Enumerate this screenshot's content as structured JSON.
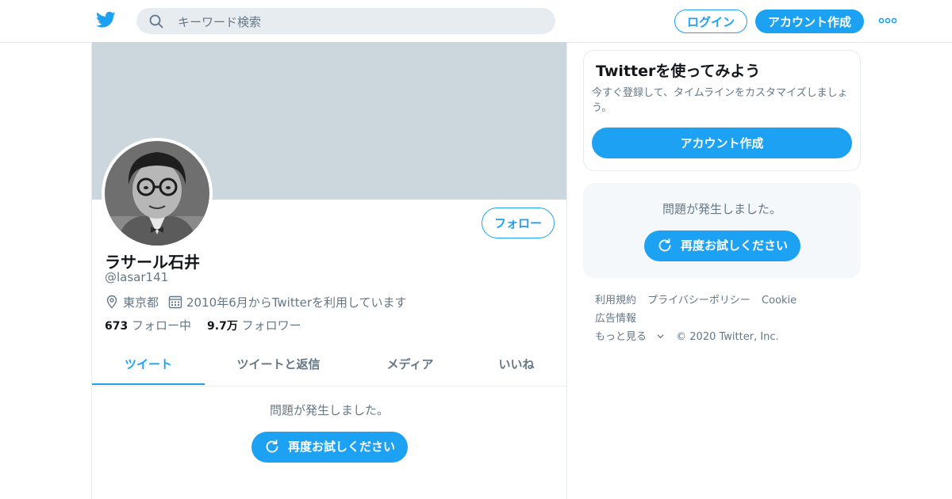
{
  "header": {
    "search_placeholder": "キーワード検索",
    "login_label": "ログイン",
    "signup_label": "アカウント作成"
  },
  "profile": {
    "display_name": "ラサール石井",
    "handle": "@lasar141",
    "follow_label": "フォロー",
    "location": "東京都",
    "joined": "2010年6月からTwitterを利用しています",
    "following_count": "673",
    "following_label": "フォロー中",
    "followers_count": "9.7万",
    "followers_label": "フォロワー"
  },
  "tabs": [
    {
      "label": "ツイート",
      "active": true
    },
    {
      "label": "ツイートと返信",
      "active": false
    },
    {
      "label": "メディア",
      "active": false
    },
    {
      "label": "いいね",
      "active": false
    }
  ],
  "timeline": {
    "error_text": "問題が発生しました。",
    "retry_label": "再度お試しください"
  },
  "sidebar": {
    "card_title": "Twitterを使ってみよう",
    "card_desc": "今すぐ登録して、タイムラインをカスタマイズしましょう。",
    "card_signup": "アカウント作成",
    "error_text": "問題が発生しました。",
    "retry_label": "再度お試しください"
  },
  "footer": {
    "terms": "利用規約",
    "privacy": "プライバシーポリシー",
    "cookie": "Cookie",
    "ads": "広告情報",
    "more": "もっと見る",
    "copyright": "© 2020 Twitter, Inc."
  },
  "colors": {
    "accent": "#1da1f2",
    "banner": "#ccd6dd",
    "secondary_text": "#657786"
  },
  "icons": [
    "twitter-logo-icon",
    "search-icon",
    "more-dots-icon",
    "location-icon",
    "calendar-icon",
    "refresh-icon",
    "chevron-down-icon"
  ]
}
